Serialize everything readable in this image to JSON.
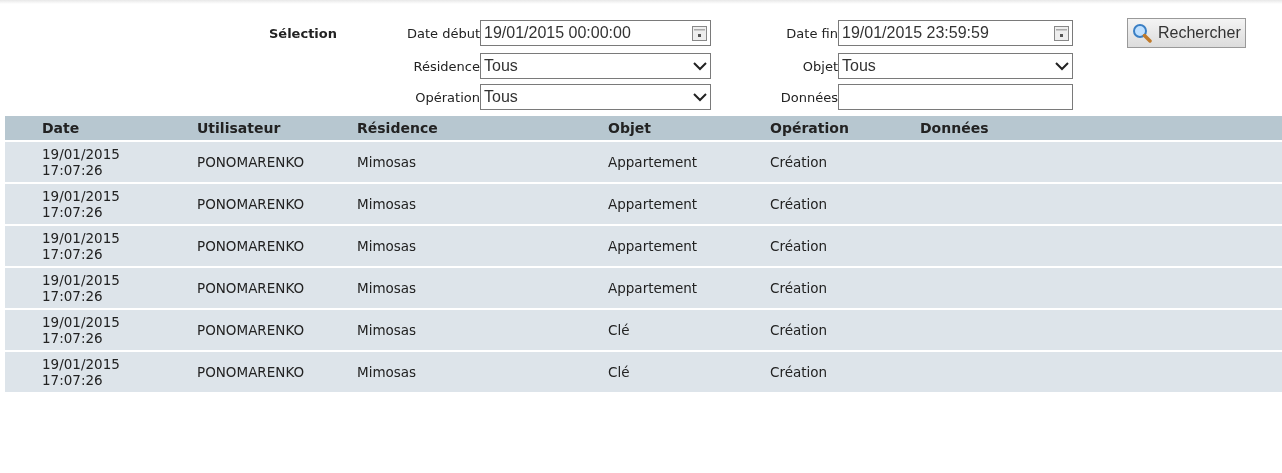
{
  "selection": {
    "title": "Sélection",
    "fields": [
      {
        "label": "Date début",
        "kind": "date",
        "value": "19/01/2015 00:00:00"
      },
      {
        "label": "Date fin",
        "kind": "date",
        "value": "19/01/2015 23:59:59"
      },
      {
        "label": "Résidence",
        "kind": "select",
        "value": "Tous"
      },
      {
        "label": "Objet",
        "kind": "select",
        "value": "Tous"
      },
      {
        "label": "Opération",
        "kind": "select",
        "value": "Tous"
      },
      {
        "label": "Données",
        "kind": "text"
      }
    ],
    "search_button": "Rechercher"
  },
  "table": {
    "columns": [
      "Date",
      "Utilisateur",
      "Résidence",
      "Objet",
      "Opération",
      "Données"
    ],
    "rows": [
      [
        "19/01/2015 17:07:26",
        "PONOMARENKO",
        "Mimosas",
        "Appartement",
        "Création"
      ],
      [
        "19/01/2015 17:07:26",
        "PONOMARENKO",
        "Mimosas",
        "Appartement",
        "Création"
      ],
      [
        "19/01/2015 17:07:26",
        "PONOMARENKO",
        "Mimosas",
        "Appartement",
        "Création"
      ],
      [
        "19/01/2015 17:07:26",
        "PONOMARENKO",
        "Mimosas",
        "Appartement",
        "Création"
      ],
      [
        "19/01/2015 17:07:26",
        "PONOMARENKO",
        "Mimosas",
        "Clé",
        "Création"
      ],
      [
        "19/01/2015 17:07:26",
        "PONOMARENKO",
        "Mimosas",
        "Clé",
        "Création"
      ]
    ]
  }
}
